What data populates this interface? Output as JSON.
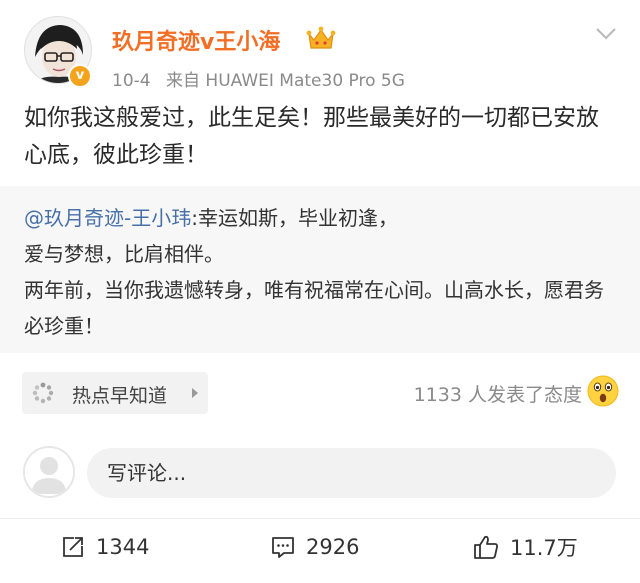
{
  "post": {
    "username": "玖月奇迹v王小海",
    "date": "10-4",
    "source_prefix": "来自",
    "device": "HUAWEI Mate30 Pro 5G",
    "verified_badge": "v",
    "content": "如你我这般爱过，此生足矣！那些最美好的一切都已安放心底，彼此珍重！"
  },
  "retweet": {
    "mention": "@玖月奇迹-王小玮",
    "text_part1": ":幸运如斯，毕业初逢，",
    "text_part2": "爱与梦想，比肩相伴。",
    "text_part3": "两年前，当你我遗憾转身，唯有祝福常在心间。山高水长，愿君务必珍重！"
  },
  "topic": {
    "label": "热点早知道"
  },
  "attitude": {
    "text": "1133 人发表了态度"
  },
  "comment": {
    "placeholder": "写评论..."
  },
  "actions": {
    "repost": "1344",
    "comments": "2926",
    "likes": "11.7万"
  },
  "colors": {
    "username": "#f26e24",
    "mention": "#4770a8",
    "badge": "#f4a31c"
  }
}
